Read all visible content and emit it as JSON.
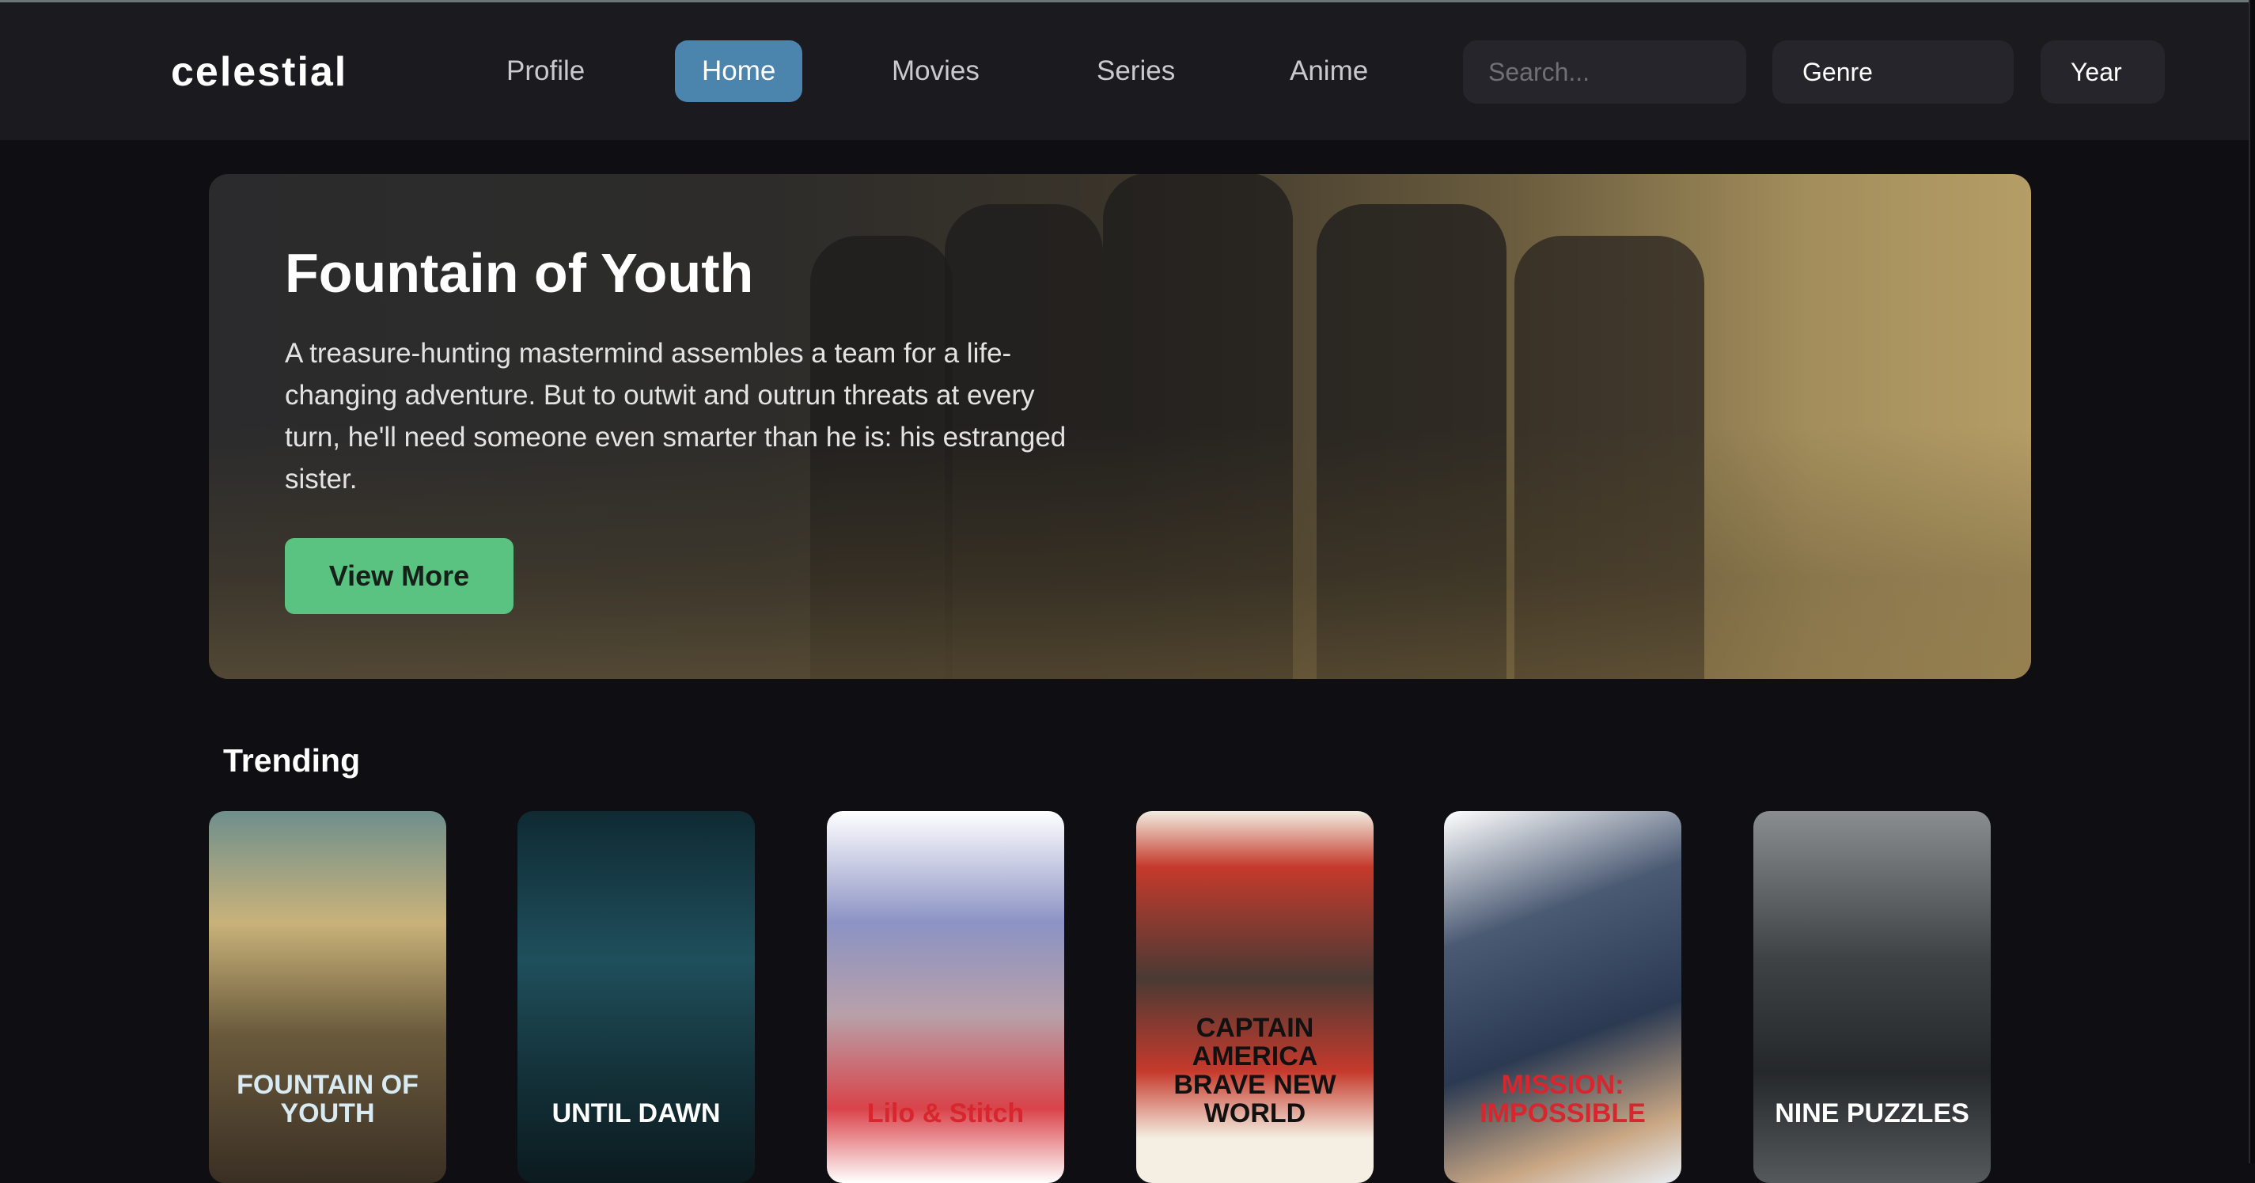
{
  "nav": {
    "logo": "celestial",
    "links": [
      "Profile",
      "Home",
      "Movies",
      "Series",
      "Anime"
    ],
    "active": "Home",
    "search_placeholder": "Search...",
    "genre": "Genre",
    "year": "Year"
  },
  "hero": {
    "title": "Fountain of Youth",
    "description": "A treasure-hunting mastermind assembles a team for a life-changing adventure. But to outwit and outrun threats at every turn, he'll need someone even smarter than he is: his estranged sister.",
    "button": "View More"
  },
  "trending": {
    "title": "Trending",
    "items": [
      {
        "title": "FOUNTAIN OF YOUTH",
        "bg": "linear-gradient(180deg,#6f8f8c 0%,#c9b27a 30%,#6a5a3c 60%,#3a2f24 100%)",
        "color": "#d8eaf2"
      },
      {
        "title": "UNTIL DAWN",
        "bg": "linear-gradient(180deg,#0f2a33 0%,#1f4f5c 40%,#14323a 70%,#0b1a1e 100%)",
        "color": "#ffffff"
      },
      {
        "title": "Lilo & Stitch",
        "bg": "linear-gradient(180deg,#ffffff 0%,#8c93c4 30%,#b8a0a8 55%,#d9434a 80%,#ffffff 100%)",
        "color": "#d8262e"
      },
      {
        "title": "CAPTAIN AMERICA BRAVE NEW WORLD",
        "bg": "linear-gradient(180deg,#f2ece0 0%,#c53a2c 15%,#4a3a34 45%,#c53a2c 70%,#f4efe2 88%)",
        "color": "#111111"
      },
      {
        "title": "MISSION: IMPOSSIBLE",
        "bg": "linear-gradient(160deg,#ffffff 0%,#4b5a73 30%,#2b3a52 60%,#c9a784 85%,#e8eef5 100%)",
        "color": "#d8262e"
      },
      {
        "title": "NINE PUZZLES",
        "bg": "linear-gradient(180deg,#8a8d90 0%,#3e4245 40%,#25282b 70%,#55595c 100%)",
        "color": "#ffffff"
      }
    ]
  }
}
